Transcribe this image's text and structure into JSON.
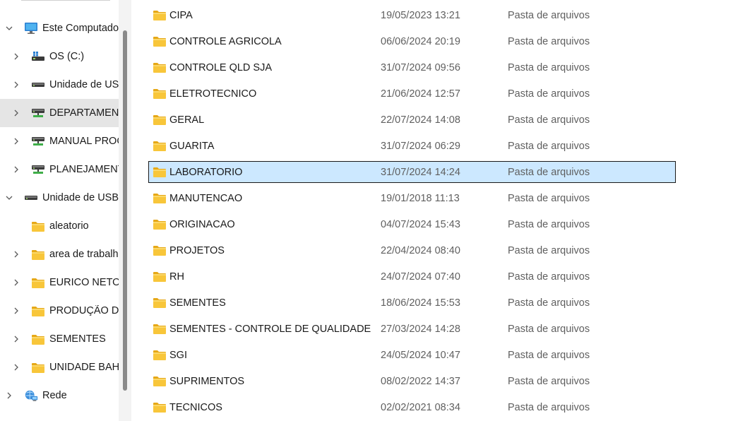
{
  "nav": {
    "items": [
      {
        "label": "Este Computador",
        "level": 0,
        "expanded": true,
        "icon": "computer-icon",
        "selected": false
      },
      {
        "label": "OS (C:)",
        "level": 1,
        "expanded": false,
        "icon": "windows-drive-icon",
        "selected": false
      },
      {
        "label": "Unidade de USB",
        "level": 1,
        "expanded": false,
        "icon": "drive-icon",
        "selected": false
      },
      {
        "label": "DEPARTAMENTOS",
        "level": 1,
        "expanded": false,
        "icon": "network-drive-icon",
        "selected": true
      },
      {
        "label": "MANUAL PROCEDIMENTOS",
        "level": 1,
        "expanded": false,
        "icon": "network-drive-icon",
        "selected": false
      },
      {
        "label": "PLANEJAMENTO",
        "level": 1,
        "expanded": false,
        "icon": "network-drive-icon",
        "selected": false
      },
      {
        "label": "Unidade de USB",
        "level": 0,
        "expanded": true,
        "icon": "drive-icon",
        "selected": false
      },
      {
        "label": "aleatorio",
        "level": 1,
        "expanded": null,
        "icon": "folder-icon",
        "selected": false
      },
      {
        "label": "area de trabalho",
        "level": 1,
        "expanded": false,
        "icon": "folder-icon",
        "selected": false
      },
      {
        "label": "EURICO NETO",
        "level": 1,
        "expanded": false,
        "icon": "folder-icon",
        "selected": false
      },
      {
        "label": "PRODUÇÃO DE",
        "level": 1,
        "expanded": false,
        "icon": "folder-icon",
        "selected": false
      },
      {
        "label": "SEMENTES",
        "level": 1,
        "expanded": false,
        "icon": "folder-icon",
        "selected": false
      },
      {
        "label": "UNIDADE BAHIA",
        "level": 1,
        "expanded": false,
        "icon": "folder-icon",
        "selected": false
      },
      {
        "label": "Rede",
        "level": 0,
        "expanded": false,
        "icon": "network-icon",
        "selected": false
      }
    ]
  },
  "files": [
    {
      "name": "CIPA",
      "date": "19/05/2023 13:21",
      "type": "Pasta de arquivos"
    },
    {
      "name": "CONTROLE AGRICOLA",
      "date": "06/06/2024 20:19",
      "type": "Pasta de arquivos"
    },
    {
      "name": "CONTROLE QLD SJA",
      "date": "31/07/2024 09:56",
      "type": "Pasta de arquivos"
    },
    {
      "name": "ELETROTECNICO",
      "date": "21/06/2024 12:57",
      "type": "Pasta de arquivos"
    },
    {
      "name": "GERAL",
      "date": "22/07/2024 14:08",
      "type": "Pasta de arquivos"
    },
    {
      "name": "GUARITA",
      "date": "31/07/2024 06:29",
      "type": "Pasta de arquivos"
    },
    {
      "name": "LABORATORIO",
      "date": "31/07/2024 14:24",
      "type": "Pasta de arquivos",
      "selected": true
    },
    {
      "name": "MANUTENCAO",
      "date": "19/01/2018 11:13",
      "type": "Pasta de arquivos"
    },
    {
      "name": "ORIGINACAO",
      "date": "04/07/2024 15:43",
      "type": "Pasta de arquivos"
    },
    {
      "name": "PROJETOS",
      "date": "22/04/2024 08:40",
      "type": "Pasta de arquivos"
    },
    {
      "name": "RH",
      "date": "24/07/2024 07:40",
      "type": "Pasta de arquivos"
    },
    {
      "name": "SEMENTES",
      "date": "18/06/2024 15:53",
      "type": "Pasta de arquivos"
    },
    {
      "name": "SEMENTES - CONTROLE DE QUALIDADE",
      "date": "27/03/2024 14:28",
      "type": "Pasta de arquivos"
    },
    {
      "name": "SGI",
      "date": "24/05/2024 10:47",
      "type": "Pasta de arquivos"
    },
    {
      "name": "SUPRIMENTOS",
      "date": "08/02/2022 14:37",
      "type": "Pasta de arquivos"
    },
    {
      "name": "TECNICOS",
      "date": "02/02/2021 08:34",
      "type": "Pasta de arquivos"
    }
  ],
  "colors": {
    "selection_bg": "#cce8ff",
    "nav_selected_bg": "#e5e5e5",
    "folder_yellow": "#f8c63a",
    "secondary_text": "#5f5f5f"
  }
}
